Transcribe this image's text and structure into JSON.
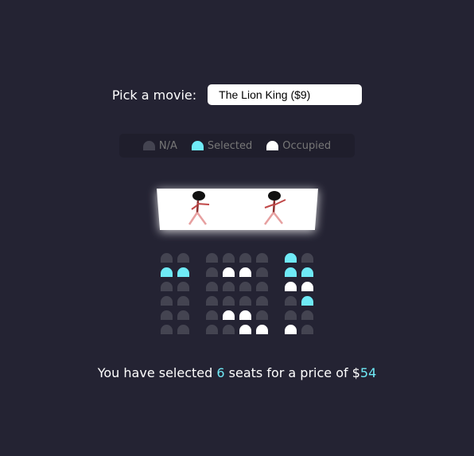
{
  "movie": {
    "label": "Pick a movie:",
    "selected": "The Lion King ($9)"
  },
  "legend": [
    {
      "label": "N/A",
      "state": "na"
    },
    {
      "label": "Selected",
      "state": "selected"
    },
    {
      "label": "Occupied",
      "state": "occupied"
    }
  ],
  "seats": [
    [
      "na",
      "na",
      "na",
      "na",
      "na",
      "na",
      "selected",
      "na"
    ],
    [
      "selected",
      "selected",
      "na",
      "occupied",
      "occupied",
      "na",
      "selected",
      "selected"
    ],
    [
      "na",
      "na",
      "na",
      "na",
      "na",
      "na",
      "occupied",
      "occupied"
    ],
    [
      "na",
      "na",
      "na",
      "na",
      "na",
      "na",
      "na",
      "selected"
    ],
    [
      "na",
      "na",
      "na",
      "occupied",
      "occupied",
      "na",
      "na",
      "na"
    ],
    [
      "na",
      "na",
      "na",
      "na",
      "occupied",
      "occupied",
      "occupied",
      "na"
    ]
  ],
  "summary": {
    "prefix": "You have selected ",
    "count": "6",
    "middle": " seats for a price of $",
    "total": "54"
  },
  "colors": {
    "background": "#242333",
    "seat_na": "#444451",
    "seat_selected": "#6feaf6",
    "seat_occupied": "#ffffff"
  }
}
